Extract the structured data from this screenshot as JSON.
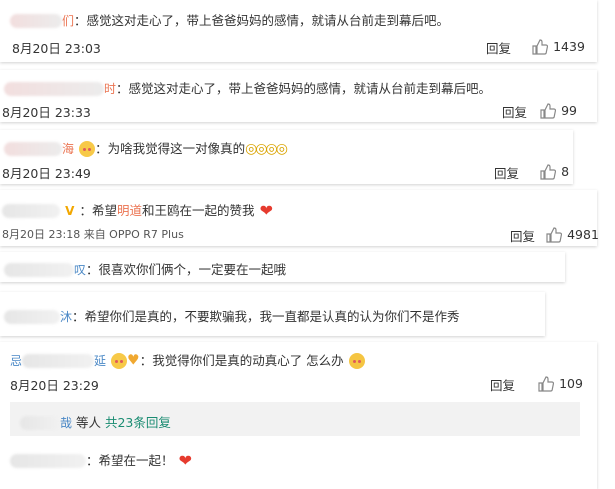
{
  "comments": [
    {
      "name_fragment": "们",
      "text": "：感觉这对走心了，带上爸爸妈妈的感情，就请从台前走到幕后吧。",
      "time": "8月20日 23:03",
      "reply_label": "回复",
      "likes": "1439"
    },
    {
      "name_fragment": "时",
      "text": "：感觉这对走心了，带上爸爸妈妈的感情，就请从台前走到幕后吧。",
      "time": "8月20日 23:33",
      "reply_label": "回复",
      "likes": "99"
    },
    {
      "name_fragment": "海",
      "text": "：为啥我觉得这一对像真的",
      "time": "8月20日 23:49",
      "reply_label": "回复",
      "likes": "8"
    },
    {
      "badge": "V",
      "text_prefix": "：希望",
      "highlight": "明道",
      "text_suffix": "和王鸥在一起的赞我",
      "time": "8月20日 23:18 来自 OPPO R7 Plus",
      "reply_label": "回复",
      "likes": "4981"
    },
    {
      "name_fragment": "叹",
      "text": "：很喜欢你们俩个，一定要在一起哦"
    },
    {
      "name_fragment": "沐",
      "text": "：希望你们是真的，不要欺骗我，我一直都是认真的认为你们不是作秀"
    },
    {
      "name_prefix": "忌",
      "name_fragment": "延",
      "text": "：我觉得你们是真的动真心了 怎么办",
      "time": "8月20日 23:29",
      "reply_label": "回复",
      "likes": "109"
    }
  ],
  "subreply": {
    "name_fragment": "哉",
    "text": " 等人 ",
    "more": "共23条回复"
  },
  "last_comment": {
    "text": "：希望在一起！"
  }
}
